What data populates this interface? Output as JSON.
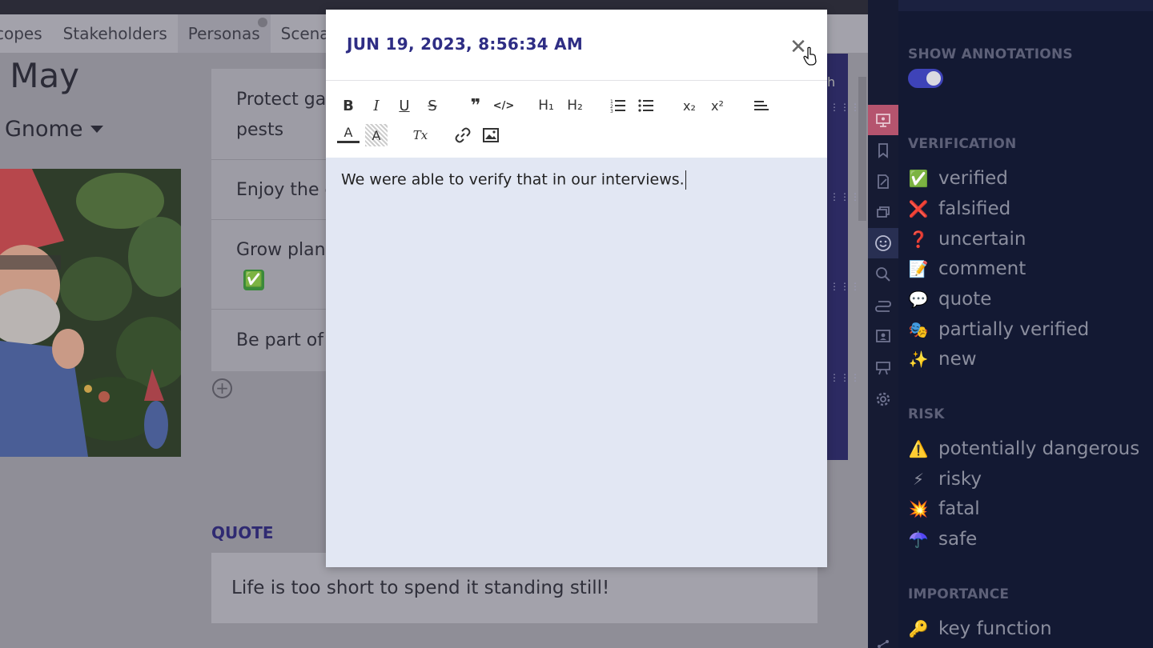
{
  "tabs": [
    {
      "label": "copes"
    },
    {
      "label": "Stakeholders"
    },
    {
      "label": "Personas"
    },
    {
      "label": "Scenari"
    }
  ],
  "persona": {
    "name": "y May",
    "type": "Gnome"
  },
  "goals": [
    {
      "line1": "Protect ga",
      "line2": "pests"
    },
    {
      "line1": "Enjoy the c"
    },
    {
      "line1": "Grow plant"
    },
    {
      "line1": "Be part of"
    }
  ],
  "goal_badge": "✅",
  "strip_header": "h",
  "quote": {
    "label": "QUOTE",
    "text": "Life is too short to spend it standing still!"
  },
  "dialog": {
    "title": "JUN 19, 2023, 8:56:34 AM",
    "close_glyph": "✕",
    "content": "We were able to verify that in our interviews."
  },
  "toolbar": {
    "bold": "B",
    "italic": "I",
    "underline": "U",
    "strike": "S",
    "quote": "❞",
    "code": "</>",
    "h1": "H₁",
    "h2": "H₂",
    "subscript": "x₂",
    "superscript": "x²",
    "text_color": "A",
    "bg_color": "A",
    "clear_format": "Tx"
  },
  "panel": {
    "show_annotations": "SHOW ANNOTATIONS",
    "toggle_on": true,
    "verification_head": "VERIFICATION",
    "verification": [
      {
        "emoji": "✅",
        "label": "verified"
      },
      {
        "emoji": "❌",
        "label": "falsified"
      },
      {
        "emoji": "❓",
        "label": "uncertain"
      },
      {
        "emoji": "📝",
        "label": "comment"
      },
      {
        "emoji": "💬",
        "label": "quote"
      },
      {
        "emoji": "🎭",
        "label": "partially verified"
      },
      {
        "emoji": "✨",
        "label": "new"
      }
    ],
    "risk_head": "RISK",
    "risk": [
      {
        "emoji": "⚠️",
        "label": "potentially dangerous"
      },
      {
        "emoji": "⚡",
        "label": "risky"
      },
      {
        "emoji": "💥",
        "label": "fatal"
      },
      {
        "emoji": "☂️",
        "label": "safe"
      }
    ],
    "importance_head": "IMPORTANCE",
    "importance": [
      {
        "emoji": "🔑",
        "label": "key function"
      }
    ]
  },
  "colors": {
    "accent": "#2e2d84",
    "panel_bg": "#131933",
    "rail_active": "#b5546e",
    "toggle": "#3e43b8"
  }
}
